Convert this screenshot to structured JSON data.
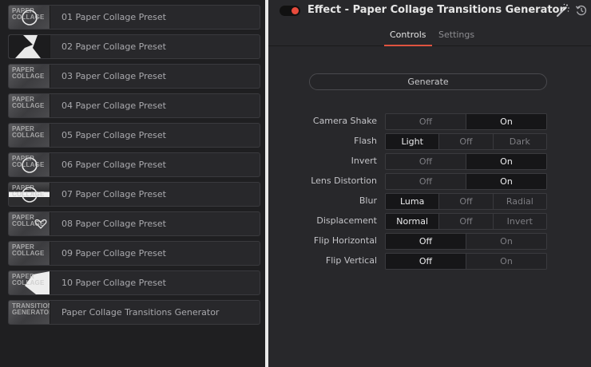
{
  "presets": [
    {
      "label": "01 Paper Collage Preset",
      "thumb": "PAPER\nCOLLAGE"
    },
    {
      "label": "02 Paper Collage Preset",
      "thumb": ""
    },
    {
      "label": "03 Paper Collage Preset",
      "thumb": "PAPER\nCOLLAGE"
    },
    {
      "label": "04 Paper Collage Preset",
      "thumb": "PAPER\nCOLLAGE"
    },
    {
      "label": "05 Paper Collage Preset",
      "thumb": "PAPER\nCOLLAGE"
    },
    {
      "label": "06 Paper Collage Preset",
      "thumb": "PAPER\nCOLLAGE"
    },
    {
      "label": "07 Paper Collage Preset",
      "thumb": "PAPER\nCOLLAGE"
    },
    {
      "label": "08 Paper Collage Preset",
      "thumb": "PAPER\nCOLLAGE"
    },
    {
      "label": "09 Paper Collage Preset",
      "thumb": "PAPER\nCOLLAGE"
    },
    {
      "label": "10 Paper Collage Preset",
      "thumb": "PAPER\nCOLLAGE"
    },
    {
      "label": "Paper Collage Transitions Generator",
      "thumb": "TRANSITION\nGENERATOR"
    }
  ],
  "inspector": {
    "title": "Effect - Paper Collage Transitions Generator",
    "enabled_color": "#e84b3c",
    "icons": [
      "magic-wand-icon",
      "reset-icon"
    ],
    "tabs": [
      {
        "label": "Controls",
        "active": true
      },
      {
        "label": "Settings",
        "active": false
      }
    ],
    "generate_label": "Generate",
    "controls": [
      {
        "label": "Camera Shake",
        "options": [
          "Off",
          "On"
        ],
        "selected": 1
      },
      {
        "label": "Flash",
        "options": [
          "Light",
          "Off",
          "Dark"
        ],
        "selected": 0
      },
      {
        "label": "Invert",
        "options": [
          "Off",
          "On"
        ],
        "selected": 1
      },
      {
        "label": "Lens Distortion",
        "options": [
          "Off",
          "On"
        ],
        "selected": 1
      },
      {
        "label": "Blur",
        "options": [
          "Luma",
          "Off",
          "Radial"
        ],
        "selected": 0
      },
      {
        "label": "Displacement",
        "options": [
          "Normal",
          "Off",
          "Invert"
        ],
        "selected": 0
      },
      {
        "label": "Flip Horizontal",
        "options": [
          "Off",
          "On"
        ],
        "selected": 0
      },
      {
        "label": "Flip Vertical",
        "options": [
          "Off",
          "On"
        ],
        "selected": 0
      }
    ]
  }
}
